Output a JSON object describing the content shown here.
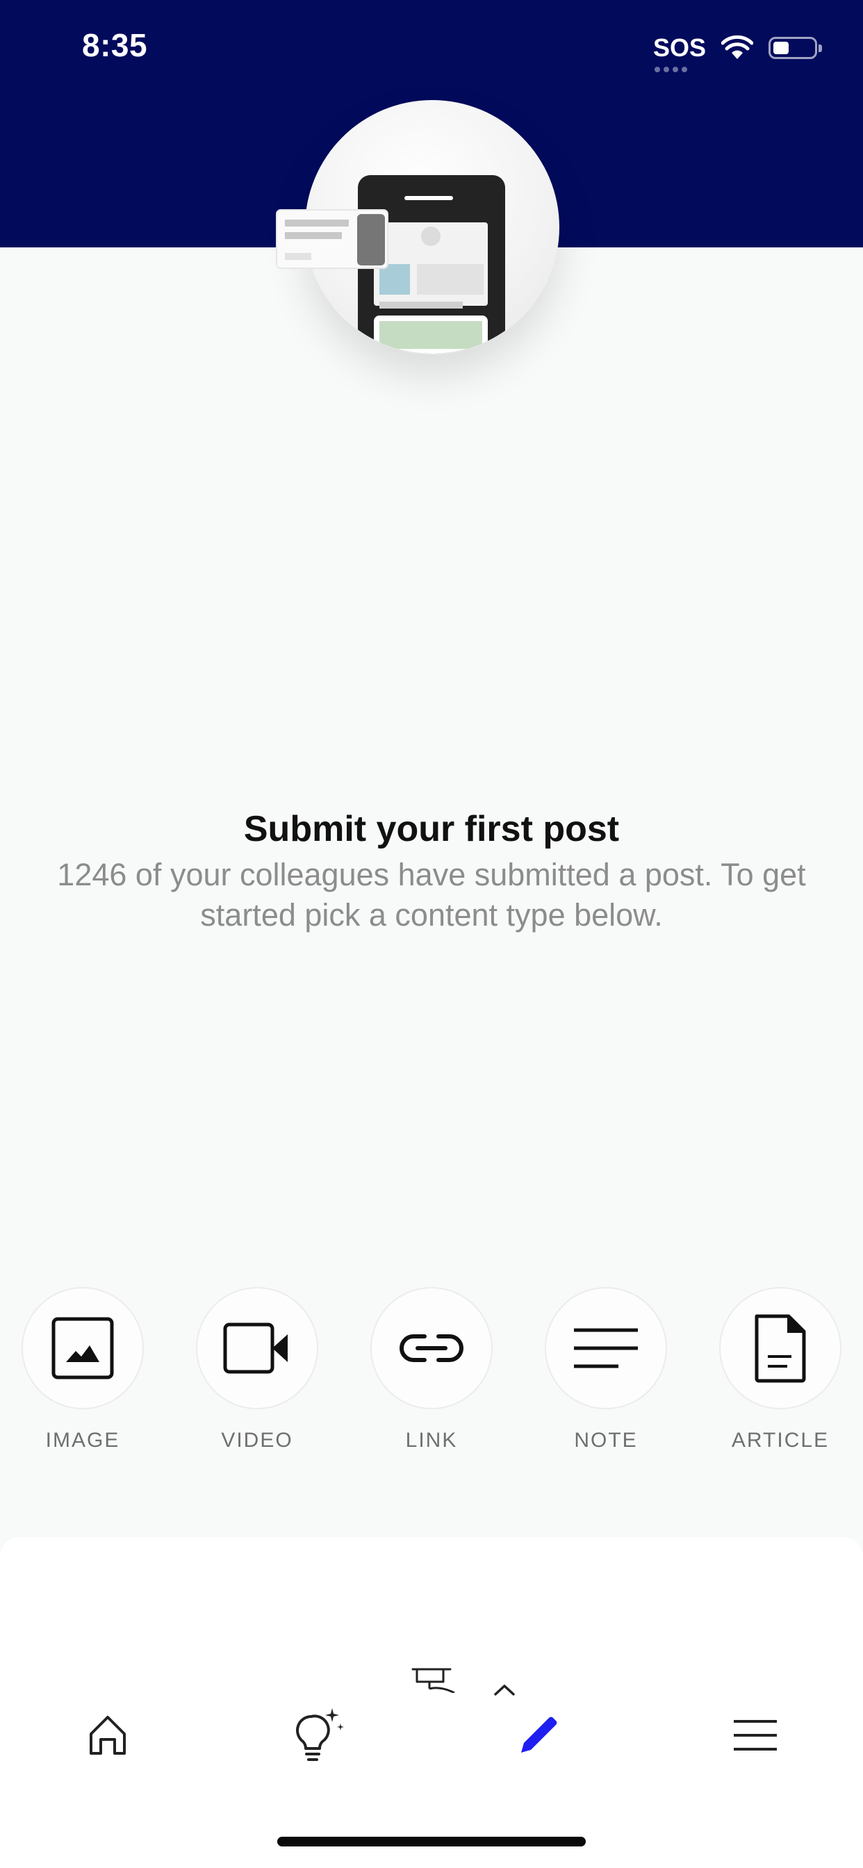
{
  "status_bar": {
    "time": "8:35",
    "carrier": "SOS"
  },
  "empty_state": {
    "title": "Submit your first post",
    "description": "1246 of your colleagues have submitted a post. To get started pick a content type below."
  },
  "content_types": [
    {
      "label": "IMAGE",
      "icon": "image-icon"
    },
    {
      "label": "VIDEO",
      "icon": "video-camera-icon"
    },
    {
      "label": "LINK",
      "icon": "link-icon"
    },
    {
      "label": "NOTE",
      "icon": "note-lines-icon"
    },
    {
      "label": "ARTICLE",
      "icon": "document-icon"
    }
  ],
  "bottom_nav": [
    {
      "icon": "home-icon",
      "active": false
    },
    {
      "icon": "lightbulb-sparkle-icon",
      "active": false
    },
    {
      "icon": "pencil-icon",
      "active": true
    },
    {
      "icon": "menu-icon",
      "active": false
    }
  ],
  "colors": {
    "header": "#020a5c",
    "accent": "#1f1ff0",
    "background": "#f8f9f9"
  }
}
